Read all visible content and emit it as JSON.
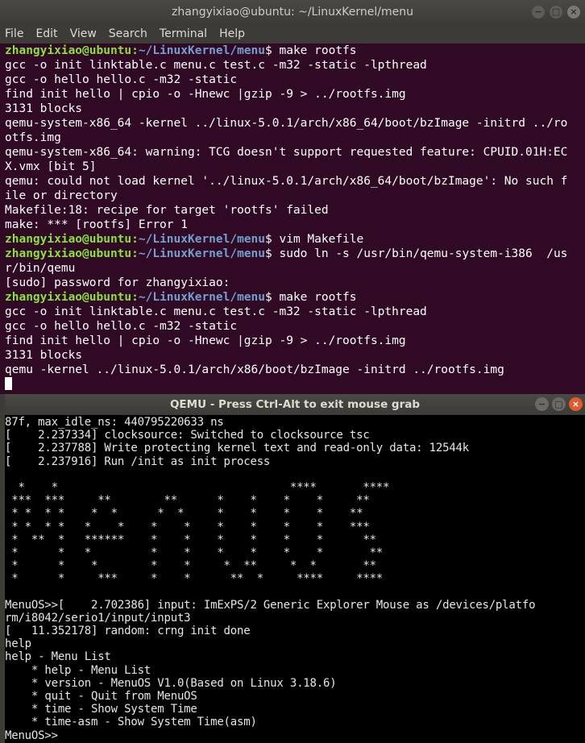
{
  "terminal": {
    "title": "zhangyixiao@ubuntu: ~/LinuxKernel/menu",
    "window_buttons": [
      "−",
      "□",
      "×"
    ],
    "menu": [
      "File",
      "Edit",
      "View",
      "Search",
      "Terminal",
      "Help"
    ],
    "colors": {
      "background": "#300a24",
      "prompt_user": "#8ae234",
      "prompt_path": "#729fcf",
      "text": "#ffffff"
    },
    "lines": [
      {
        "user": "zhangyixiao@ubuntu",
        "path": "~/LinuxKernel/menu",
        "cmd": " make rootfs"
      },
      {
        "text": "gcc -o init linktable.c menu.c test.c -m32 -static -lpthread"
      },
      {
        "text": "gcc -o hello hello.c -m32 -static"
      },
      {
        "text": "find init hello | cpio -o -Hnewc |gzip -9 > ../rootfs.img"
      },
      {
        "text": "3131 blocks"
      },
      {
        "text": "qemu-system-x86_64 -kernel ../linux-5.0.1/arch/x86_64/boot/bzImage -initrd ../ro"
      },
      {
        "text": "otfs.img"
      },
      {
        "text": "qemu-system-x86_64: warning: TCG doesn't support requested feature: CPUID.01H:EC"
      },
      {
        "text": "X.vmx [bit 5]"
      },
      {
        "text": "qemu: could not load kernel '../linux-5.0.1/arch/x86_64/boot/bzImage': No such f"
      },
      {
        "text": "ile or directory"
      },
      {
        "text": "Makefile:18: recipe for target 'rootfs' failed"
      },
      {
        "text": "make: *** [rootfs] Error 1"
      },
      {
        "user": "zhangyixiao@ubuntu",
        "path": "~/LinuxKernel/menu",
        "cmd": " vim Makefile"
      },
      {
        "user": "zhangyixiao@ubuntu",
        "path": "~/LinuxKernel/menu",
        "cmd": " sudo ln -s /usr/bin/qemu-system-i386  /us"
      },
      {
        "text": "r/bin/qemu"
      },
      {
        "text": "[sudo] password for zhangyixiao:"
      },
      {
        "user": "zhangyixiao@ubuntu",
        "path": "~/LinuxKernel/menu",
        "cmd": " make rootfs"
      },
      {
        "text": "gcc -o init linktable.c menu.c test.c -m32 -static -lpthread"
      },
      {
        "text": "gcc -o hello hello.c -m32 -static"
      },
      {
        "text": "find init hello | cpio -o -Hnewc |gzip -9 > ../rootfs.img"
      },
      {
        "text": "3131 blocks"
      },
      {
        "text": "qemu -kernel ../linux-5.0.1/arch/x86/boot/bzImage -initrd ../rootfs.img"
      },
      {
        "cursor": true
      }
    ]
  },
  "qemu": {
    "title": "QEMU - Press Ctrl-Alt to exit mouse grab",
    "window_buttons": [
      "−",
      "□",
      "×"
    ],
    "lines": [
      "87f, max_idle_ns: 440795220633 ns",
      "[    2.237334] clocksource: Switched to clocksource tsc",
      "[    2.237788] Write protecting kernel text and read-only data: 12544k",
      "[    2.237916] Run /init as init process",
      "",
      "  *    *                                   ****       ****",
      " ***  ***     **        **      *    *    *    *     **",
      " * *  * *    *  *      *  *     *    *    *    *    **",
      " * *  * *   *    *    *    *    *    *    *    *    ***",
      " *  **  *   ******    *    *    *    *    *    *      **",
      " *      *   *         *    *    *    *    *    *       **",
      " *      *    *        *    *     *  **     *  *       **",
      " *      *     ***     *    *      **  *     ****     ****",
      "",
      "MenuOS>>[    2.702386] input: ImExPS/2 Generic Explorer Mouse as /devices/platfo",
      "rm/i8042/serio1/input/input3",
      "[   11.352178] random: crng init done",
      "help",
      "help - Menu List",
      "    * help - Menu List",
      "    * version - MenuOS V1.0(Based on Linux 3.18.6)",
      "    * quit - Quit from MenuOS",
      "    * time - Show System Time",
      "    * time-asm - Show System Time(asm)",
      "MenuOS>>"
    ]
  }
}
